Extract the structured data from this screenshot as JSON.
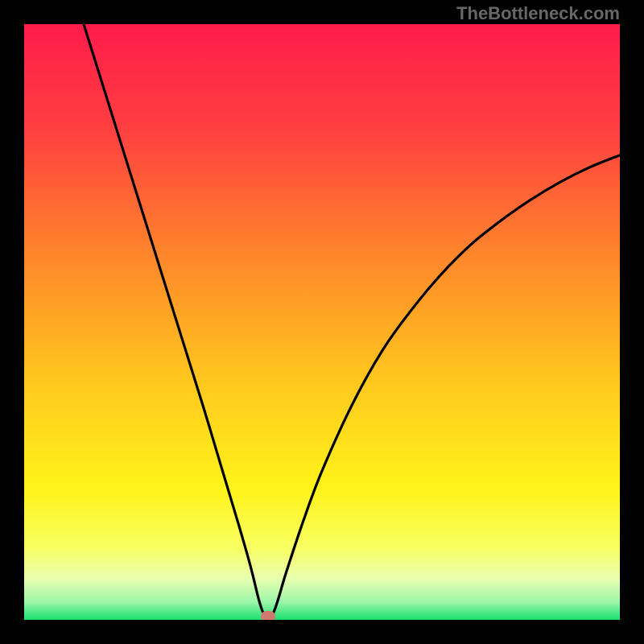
{
  "watermark": "TheBottleneck.com",
  "colors": {
    "frame": "#000000",
    "curve": "#000000",
    "marker": "#cf7a70",
    "gradient_stops": [
      {
        "offset": 0.0,
        "color": "#ff1b4b"
      },
      {
        "offset": 0.18,
        "color": "#ff4040"
      },
      {
        "offset": 0.4,
        "color": "#ff8a2a"
      },
      {
        "offset": 0.6,
        "color": "#ffc81e"
      },
      {
        "offset": 0.78,
        "color": "#fff31a"
      },
      {
        "offset": 0.88,
        "color": "#f8ff62"
      },
      {
        "offset": 0.93,
        "color": "#eaffb0"
      },
      {
        "offset": 0.97,
        "color": "#9cf6a9"
      },
      {
        "offset": 1.0,
        "color": "#19e070"
      }
    ]
  },
  "chart_data": {
    "type": "line",
    "title": "",
    "xlabel": "",
    "ylabel": "",
    "xlim": [
      0,
      100
    ],
    "ylim": [
      0,
      100
    ],
    "series": [
      {
        "name": "curve",
        "x": [
          10,
          15,
          20,
          25,
          30,
          33,
          36,
          38,
          39.5,
          40.5,
          41.5,
          42.5,
          44,
          47,
          50,
          55,
          60,
          65,
          70,
          75,
          80,
          85,
          90,
          95,
          100
        ],
        "y": [
          100,
          84,
          68,
          52,
          36,
          26,
          16,
          9,
          3,
          0.5,
          0.5,
          3,
          8,
          17,
          25,
          36,
          45,
          52,
          58,
          63,
          67,
          70.5,
          73.5,
          76,
          78
        ]
      }
    ],
    "marker": {
      "x": 41,
      "y": 0.5
    },
    "annotations": []
  }
}
